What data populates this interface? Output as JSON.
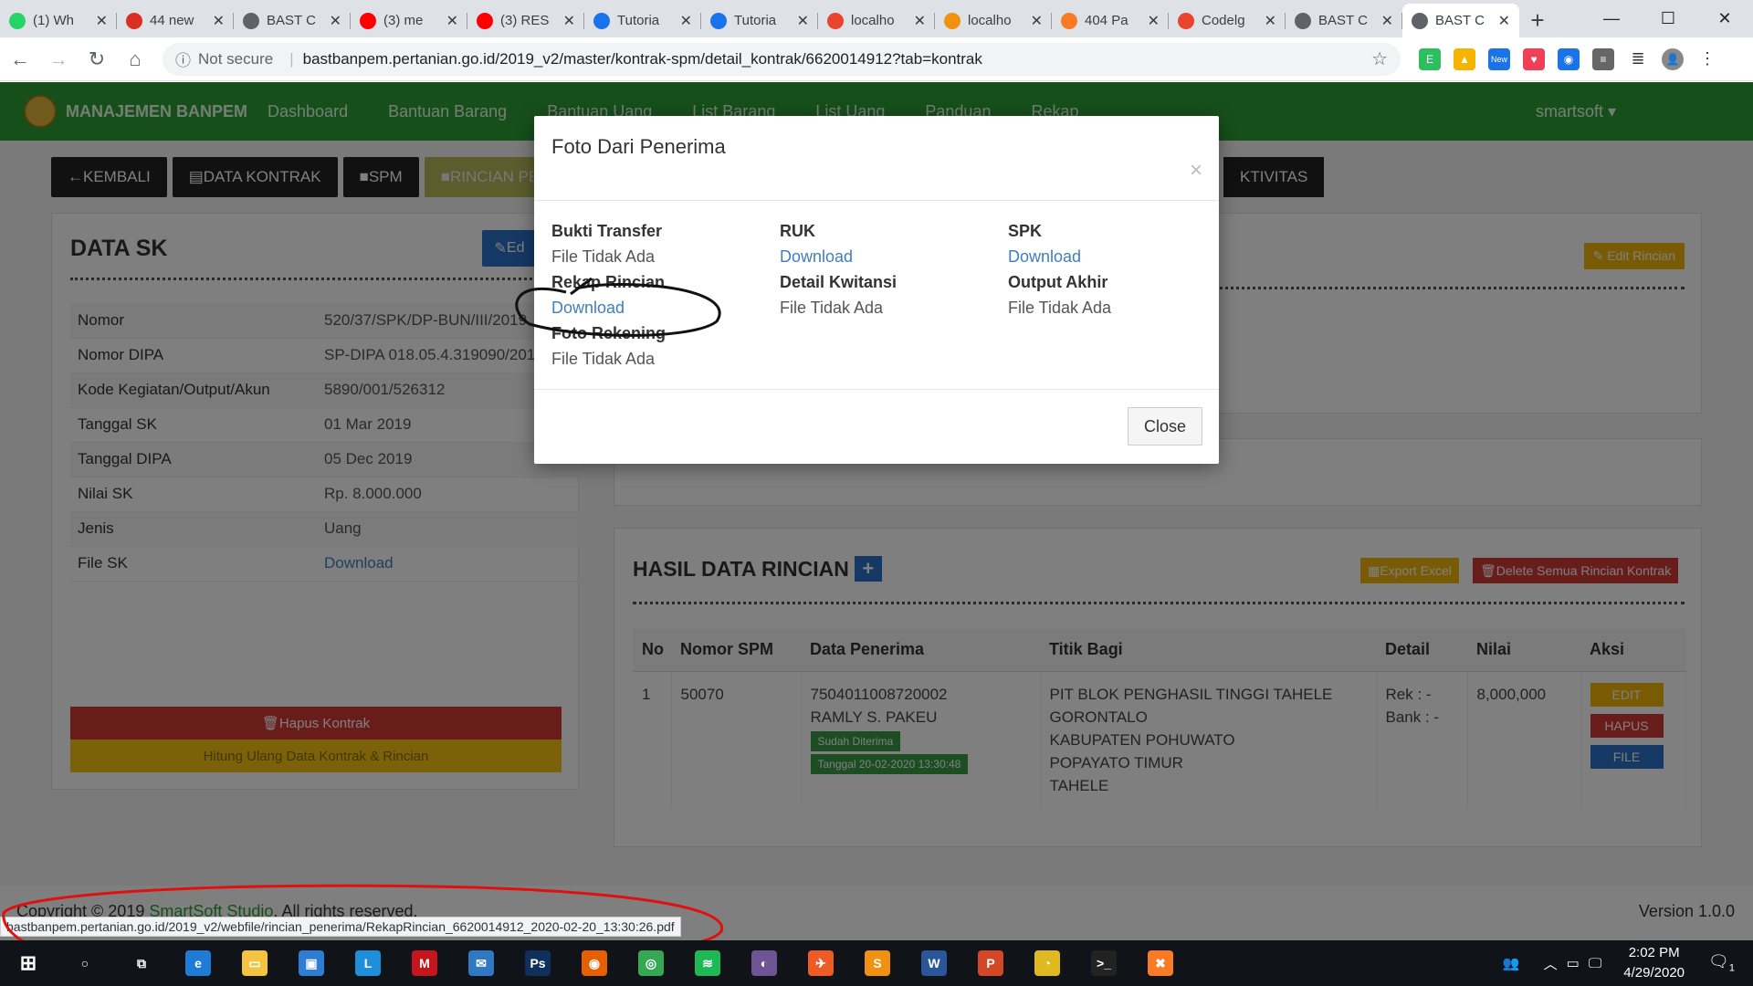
{
  "browser": {
    "tabs": [
      {
        "title": "(1) Wh",
        "fav": "whatsapp-icon",
        "color": "#25d366"
      },
      {
        "title": "44 new",
        "fav": "gmail-icon",
        "color": "#d93025"
      },
      {
        "title": "BAST C",
        "fav": "globe-icon",
        "color": "#5f6368"
      },
      {
        "title": "(3) me",
        "fav": "youtube-icon",
        "color": "#ff0000"
      },
      {
        "title": "(3) RES",
        "fav": "youtube-icon",
        "color": "#ff0000"
      },
      {
        "title": "Tutoria",
        "fav": "book-icon",
        "color": "#1a73e8"
      },
      {
        "title": "Tutoria",
        "fav": "book-icon",
        "color": "#1a73e8"
      },
      {
        "title": "localho",
        "fav": "codeigniter-icon",
        "color": "#e8442e"
      },
      {
        "title": "localho",
        "fav": "phpmyadmin-icon",
        "color": "#f29111"
      },
      {
        "title": "404 Pa",
        "fav": "xampp-icon",
        "color": "#fb7a24"
      },
      {
        "title": "Codelg",
        "fav": "codeigniter-icon",
        "color": "#e8442e"
      },
      {
        "title": "BAST C",
        "fav": "globe-icon",
        "color": "#5f6368"
      },
      {
        "title": "BAST C",
        "fav": "globe-icon",
        "color": "#5f6368",
        "active": true
      }
    ],
    "security": "Not secure",
    "url": "bastbanpem.pertanian.go.id/2019_v2/master/kontrak-spm/detail_kontrak/6620014912?tab=kontrak",
    "extension_badge": "New"
  },
  "navbar": {
    "brand": "MANAJEMEN BANPEM",
    "items": [
      "Dashboard",
      "Bantuan Barang",
      "Bantuan Uang",
      "List Barang",
      "List Uang",
      "Panduan",
      "Rekap"
    ],
    "user": "smartsoft ▾"
  },
  "buttons": {
    "kembali": "KEMBALI",
    "data_kontrak": "DATA KONTRAK",
    "spm": "SPM",
    "rincian": "RINCIAN PE",
    "aktivitas": "KTIVITAS"
  },
  "data_sk": {
    "title": "DATA SK",
    "edit": "Ed",
    "rows": [
      {
        "k": "Nomor",
        "v": "520/37/SPK/DP-BUN/III/2019"
      },
      {
        "k": "Nomor DIPA",
        "v": "SP-DIPA 018.05.4.319090/201"
      },
      {
        "k": "Kode Kegiatan/Output/Akun",
        "v": "5890/001/526312"
      },
      {
        "k": "Tanggal SK",
        "v": "01 Mar 2019"
      },
      {
        "k": "Tanggal DIPA",
        "v": "05 Dec 2019"
      },
      {
        "k": "Nilai SK",
        "v": "Rp. 8.000.000"
      },
      {
        "k": "Jenis",
        "v": "Uang"
      },
      {
        "k": "File SK",
        "v": "Download"
      }
    ],
    "hapus": "Hapus Kontrak",
    "hitung": "Hitung Ulang Data Kontrak & Rincian"
  },
  "edit_rincian": "Edit Rincian",
  "hasil": {
    "title": "HASIL DATA RINCIAN",
    "plus": "+",
    "export": "Export Excel",
    "delete_all": "Delete Semua Rincian Kontrak",
    "columns": [
      "No",
      "Nomor SPM",
      "Data Penerima",
      "Titik Bagi",
      "Detail",
      "Nilai",
      "Aksi"
    ],
    "row": {
      "no": "1",
      "spm": "50070",
      "nik": "7504011008720002",
      "nama": "RAMLY S. PAKEU",
      "status": "Sudah Diterima",
      "tanggal": "Tanggal 20-02-2020 13:30:48",
      "titik": [
        "PIT BLOK PENGHASIL TINGGI TAHELE",
        "GORONTALO",
        "KABUPATEN POHUWATO",
        "POPAYATO TIMUR",
        "TAHELE"
      ],
      "rek": "Rek : -",
      "bank": "Bank : -",
      "nilai": "8,000,000",
      "aksi": [
        "EDIT",
        "HAPUS",
        "FILE"
      ]
    }
  },
  "footer": {
    "copy_prefix": "Copyright © 2019 ",
    "copy_link": "SmartSoft Studio",
    "copy_suffix": ". All rights reserved.",
    "version": "Version 1.0.0"
  },
  "modal": {
    "title": "Foto Dari Penerima",
    "close_x": "×",
    "col1": [
      {
        "h": "Bukti Transfer",
        "v": "File Tidak Ada",
        "link": false
      },
      {
        "h": "Rekap Rincian",
        "v": "Download",
        "link": true
      },
      {
        "h": "Foto Rekening",
        "v": "File Tidak Ada",
        "link": false
      }
    ],
    "col2": [
      {
        "h": "RUK",
        "v": "Download",
        "link": true
      },
      {
        "h": "Detail Kwitansi",
        "v": "File Tidak Ada",
        "link": false
      }
    ],
    "col3": [
      {
        "h": "SPK",
        "v": "Download",
        "link": true
      },
      {
        "h": "Output Akhir",
        "v": "File Tidak Ada",
        "link": false
      }
    ],
    "close_button": "Close"
  },
  "status_url": "bastbanpem.pertanian.go.id/2019_v2/webfile/rincian_penerima/RekapRincian_6620014912_2020-02-20_13:30:26.pdf",
  "taskbar": {
    "apps": [
      {
        "name": "cortana-icon",
        "color": "#101418"
      },
      {
        "name": "task-view-icon",
        "color": "#101418"
      },
      {
        "name": "edge-icon",
        "color": "#1e7cd6"
      },
      {
        "name": "file-explorer-icon",
        "color": "#f5c342"
      },
      {
        "name": "store-icon",
        "color": "#2d7dd2"
      },
      {
        "name": "l-app-icon",
        "color": "#1f8fdb"
      },
      {
        "name": "mcafee-icon",
        "color": "#c4161c"
      },
      {
        "name": "mail-icon",
        "color": "#2f78c4"
      },
      {
        "name": "photoshop-icon",
        "color": "#0f2f5c"
      },
      {
        "name": "firefox-icon",
        "color": "#e66000"
      },
      {
        "name": "chrome-icon",
        "color": "#34a853"
      },
      {
        "name": "spotify-icon",
        "color": "#1db954"
      },
      {
        "name": "github-icon",
        "color": "#6e5494"
      },
      {
        "name": "postman-icon",
        "color": "#ef5b25"
      },
      {
        "name": "sublime-icon",
        "color": "#f29111"
      },
      {
        "name": "word-icon",
        "color": "#2b579a"
      },
      {
        "name": "powerpoint-icon",
        "color": "#d24726"
      },
      {
        "name": "dbeaver-icon",
        "color": "#e0b820"
      },
      {
        "name": "terminal-icon",
        "color": "#222222"
      },
      {
        "name": "xampp-icon",
        "color": "#fb7a24"
      }
    ],
    "time": "2:02 PM",
    "date": "4/29/2020",
    "notif": "1"
  }
}
